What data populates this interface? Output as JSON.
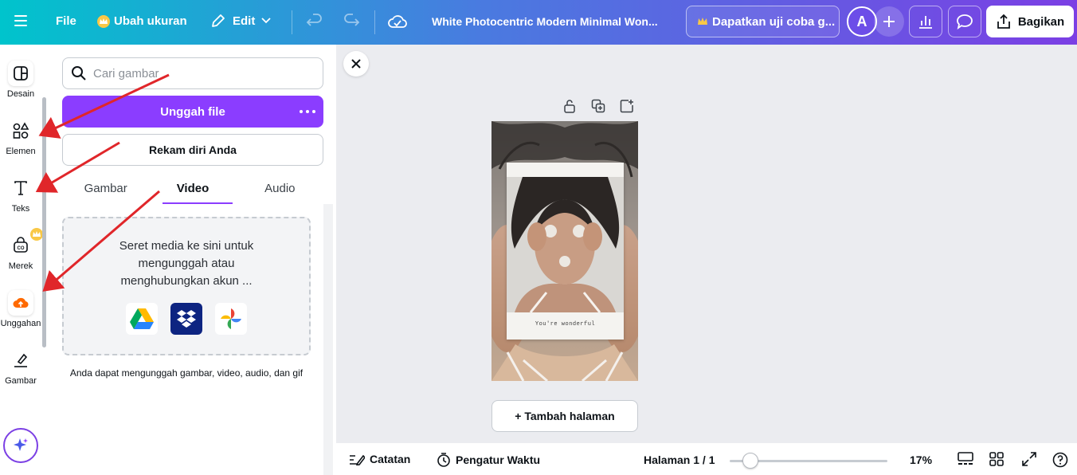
{
  "topbar": {
    "file_label": "File",
    "resize_label": "Ubah ukuran",
    "edit_label": "Edit",
    "doc_title": "White Photocentric Modern Minimal Won...",
    "trial_label": "Dapatkan uji coba g...",
    "avatar_letter": "A",
    "share_label": "Bagikan"
  },
  "rail": {
    "items": [
      {
        "label": "Desain",
        "icon": "layout-icon"
      },
      {
        "label": "Elemen",
        "icon": "shapes-icon"
      },
      {
        "label": "Teks",
        "icon": "text-icon"
      },
      {
        "label": "Merek",
        "icon": "brand-icon"
      },
      {
        "label": "Unggahan",
        "icon": "cloud-upload-icon"
      },
      {
        "label": "Gambar",
        "icon": "draw-icon"
      }
    ]
  },
  "panel": {
    "search_placeholder": "Cari gambar",
    "upload_label": "Unggah file",
    "record_label": "Rekam diri Anda",
    "tabs": [
      "Gambar",
      "Video",
      "Audio"
    ],
    "active_tab": "Video",
    "dropzone_text": "Seret media ke sini untuk mengunggah atau menghubungkan akun ...",
    "services": [
      "google-drive-icon",
      "dropbox-icon",
      "google-photos-icon"
    ],
    "note": "Anda dapat mengunggah gambar, video, audio, dan gif"
  },
  "canvas": {
    "photo_caption": "You're wonderful",
    "add_page_label": "+ Tambah halaman"
  },
  "bottombar": {
    "notes_label": "Catatan",
    "timer_label": "Pengatur Waktu",
    "page_label": "Halaman 1 / 1",
    "zoom_label": "17%",
    "zoom_level": 0.17
  },
  "colors": {
    "accent": "#8b3dff",
    "arrow": "#e0262a"
  }
}
